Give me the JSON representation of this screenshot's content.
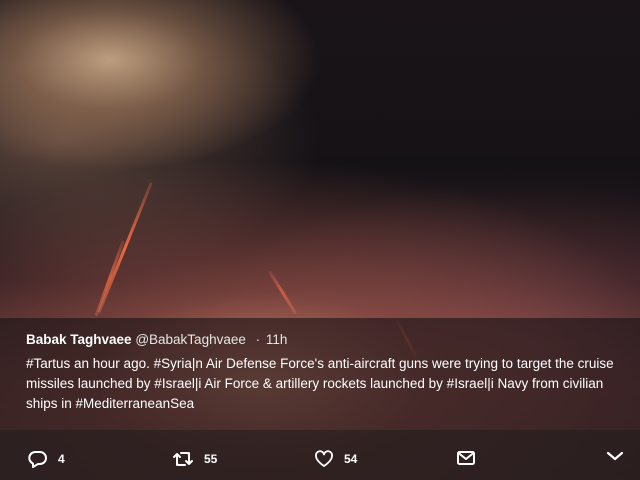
{
  "tweet": {
    "author_name": "Babak Taghvaee",
    "author_handle": "@BabakTaghvaee",
    "separator": "·",
    "time": "11h",
    "text": "#Tartus an hour ago. #Syria|n Air Defense Force's anti-aircraft guns were trying to target the cruise missiles launched by #Israel|i Air Force & artillery rockets launched by #Israel|i Navy from civilian ships in #MediterraneanSea"
  },
  "actions": {
    "reply": {
      "icon": "reply-icon",
      "count": "4"
    },
    "retweet": {
      "icon": "retweet-icon",
      "count": "55"
    },
    "like": {
      "icon": "heart-icon",
      "count": "54"
    },
    "message": {
      "icon": "envelope-icon"
    },
    "more": {
      "icon": "chevron-down-icon"
    }
  },
  "colors": {
    "text": "#ffffff",
    "overlay": "#181416"
  }
}
